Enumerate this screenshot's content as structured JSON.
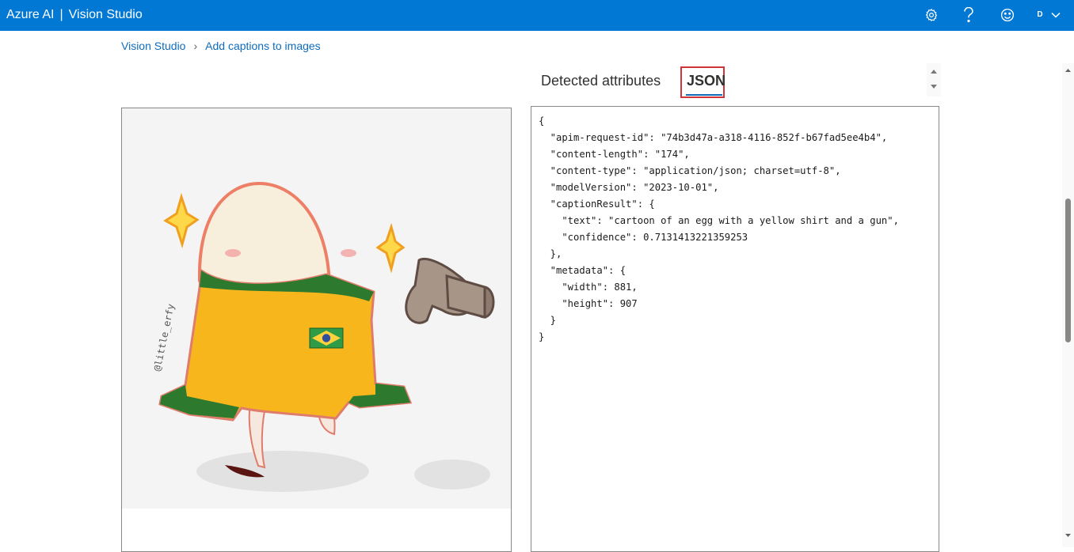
{
  "header": {
    "brand_left": "Azure AI",
    "brand_sep": "|",
    "brand_right": "Vision Studio",
    "user_initial": "D"
  },
  "breadcrumb": {
    "root": "Vision Studio",
    "current": "Add captions to images"
  },
  "tabs": {
    "detected": "Detected attributes",
    "json": "JSON"
  },
  "json_output": "{\n  \"apim-request-id\": \"74b3d47a-a318-4116-852f-b67fad5ee4b4\",\n  \"content-length\": \"174\",\n  \"content-type\": \"application/json; charset=utf-8\",\n  \"modelVersion\": \"2023-10-01\",\n  \"captionResult\": {\n    \"text\": \"cartoon of an egg with a yellow shirt and a gun\",\n    \"confidence\": 0.7131413221359253\n  },\n  \"metadata\": {\n    \"width\": 881,\n    \"height\": 907\n  }\n}",
  "image": {
    "watermark": "@little_erfy"
  },
  "icons": {
    "settings": "gear-icon",
    "help": "help-icon",
    "feedback": "smiley-icon",
    "account_menu": "chevron-down-icon"
  },
  "colors": {
    "brand": "#0078d4",
    "link": "#0f6cbd",
    "highlight_border": "#d13438"
  }
}
